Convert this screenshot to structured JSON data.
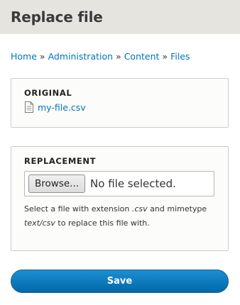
{
  "page": {
    "title": "Replace file"
  },
  "breadcrumb": {
    "items": [
      "Home",
      "Administration",
      "Content",
      "Files"
    ],
    "separator": "»"
  },
  "original": {
    "legend": "ORIGINAL",
    "file_icon": "document-icon",
    "file_name": "my-file.csv"
  },
  "replacement": {
    "legend": "REPLACEMENT",
    "browse_label": "Browse...",
    "no_file_text": "No file selected.",
    "help": {
      "part1": "Select a file with extension ",
      "extension": ".csv",
      "part2": " and mimetype ",
      "mimetype": "text/csv",
      "part3": " to replace this file with."
    }
  },
  "actions": {
    "save_label": "Save"
  },
  "colors": {
    "link": "#0074bd",
    "header_bg": "#e6e4df",
    "primary_button": "#0168a8"
  }
}
